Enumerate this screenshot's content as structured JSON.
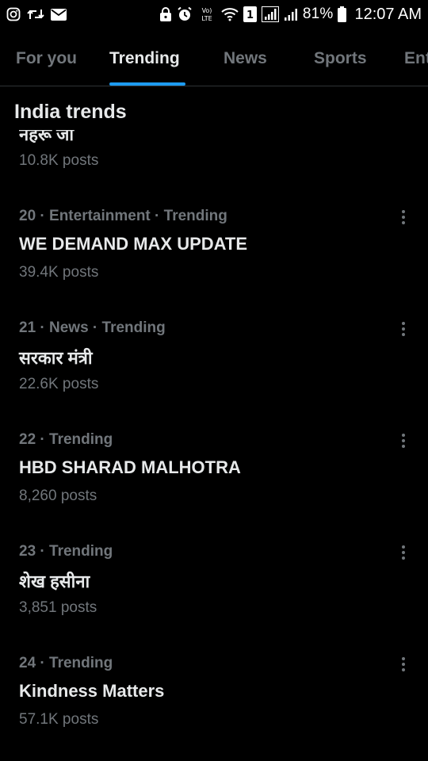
{
  "status_bar": {
    "left_icons": [
      "instagram-icon",
      "repost-icon",
      "mail-icon"
    ],
    "right_icons": [
      "lock-icon",
      "alarm-icon",
      "volte-icon",
      "wifi-icon",
      "sim-1-icon",
      "signal-1-icon",
      "signal-2-icon",
      "battery-icon"
    ],
    "volte_text": "Vo) LTE",
    "sim_label": "1",
    "battery": "81%",
    "time": "12:07 AM"
  },
  "tabs": [
    {
      "label": "For you",
      "active": false
    },
    {
      "label": "Trending",
      "active": true
    },
    {
      "label": "News",
      "active": false
    },
    {
      "label": "Sports",
      "active": false
    },
    {
      "label": "Ent",
      "active": false
    }
  ],
  "section_title": "India trends",
  "partial_trend": {
    "title": "नेहरू जी",
    "posts": "10.8K posts"
  },
  "trends": [
    {
      "meta": "20 · Entertainment · Trending",
      "name": "WE DEMAND MAX UPDATE",
      "posts": "39.4K posts"
    },
    {
      "meta": "21 · News · Trending",
      "name": "सरकार मंत्री",
      "posts": "22.6K posts"
    },
    {
      "meta": "22 · Trending",
      "name": "HBD SHARAD MALHOTRA",
      "posts": "8,260 posts"
    },
    {
      "meta": "23 · Trending",
      "name": "शेख हसीना",
      "posts": "3,851 posts"
    },
    {
      "meta": "24 · Trending",
      "name": "Kindness Matters",
      "posts": "57.1K posts"
    }
  ],
  "colors": {
    "background": "#000000",
    "primary_text": "#e7e9ea",
    "secondary_text": "#71767b",
    "accent": "#1d9bf0",
    "divider": "#2f3336"
  }
}
